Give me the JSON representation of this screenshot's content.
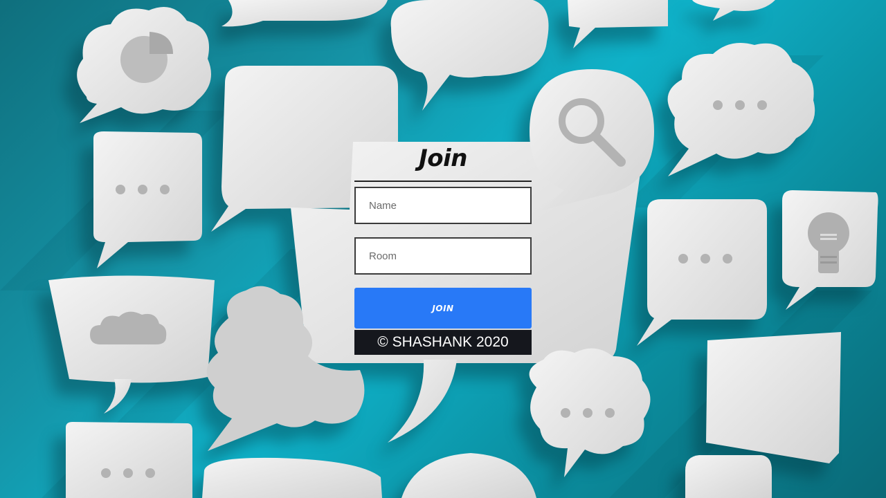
{
  "join_form": {
    "title": "Join",
    "name_placeholder": "Name",
    "room_placeholder": "Room",
    "join_button_label": "JOIN",
    "footer_text": "© SHASHANK 2020"
  },
  "colors": {
    "button": "#2879f7",
    "footer_bg": "#15171d",
    "background_teal": "#1593a6",
    "bubble": "#e6e6e6"
  },
  "background_icons": [
    "pie-chart-icon",
    "search-icon",
    "lightbulb-icon",
    "cloud-icon",
    "ellipsis-icon"
  ]
}
